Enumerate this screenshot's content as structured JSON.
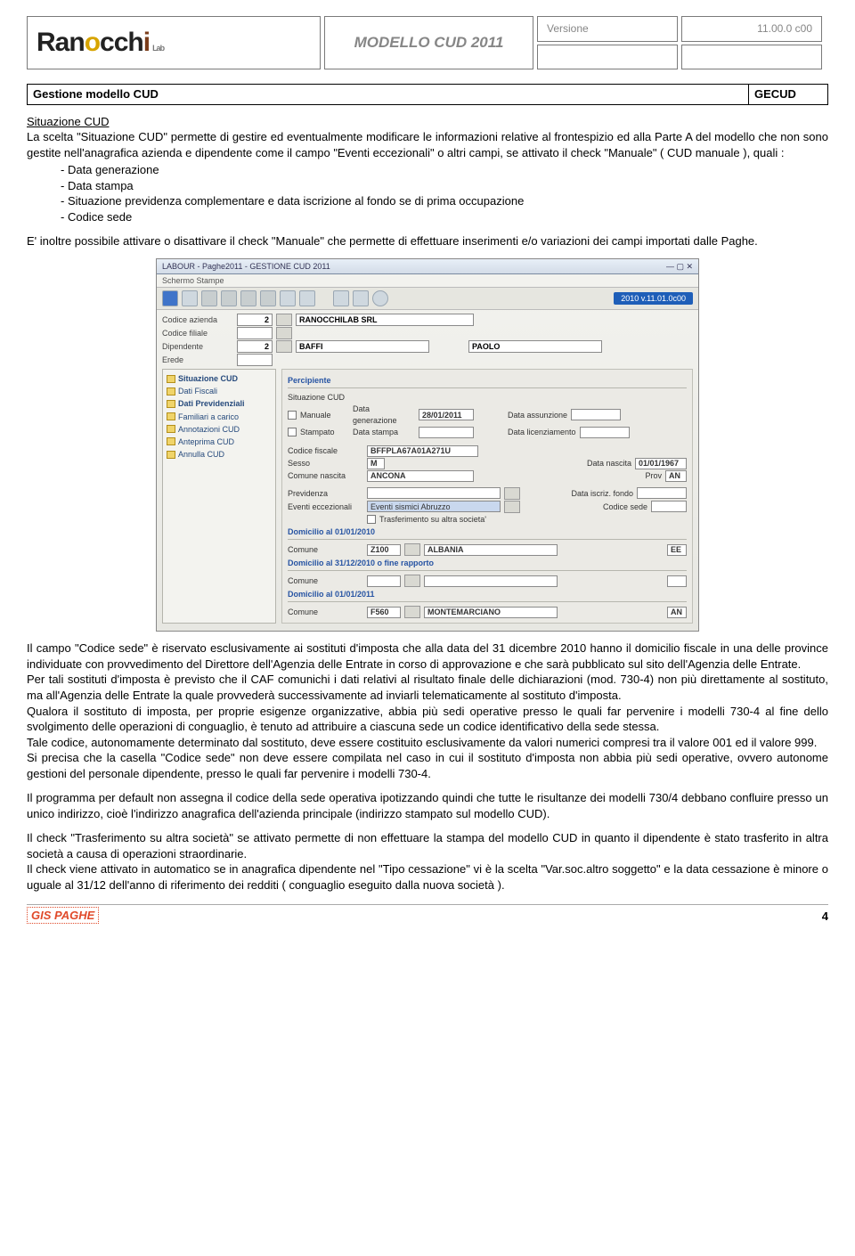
{
  "header": {
    "brand_main": "Ran",
    "brand_o1": "o",
    "brand_mid": "cch",
    "brand_o2": "i",
    "brand_tail": "Lab",
    "doc_title": "MODELLO CUD 2011",
    "version_label": "Versione",
    "version_value": "11.00.0 c00"
  },
  "box": {
    "title": "Gestione modello CUD",
    "code": "GECUD"
  },
  "intro": {
    "heading": "Situazione CUD",
    "p1": "La scelta \"Situazione CUD\" permette di gestire ed eventualmente modificare le informazioni relative al frontespizio ed alla Parte A del modello che non sono gestite nell'anagrafica azienda e dipendente come il campo \"Eventi eccezionali\" o altri campi, se attivato il check \"Manuale\" ( CUD manuale ), quali :",
    "list": [
      "Data generazione",
      "Data stampa",
      "Situazione previdenza complementare e data iscrizione al fondo se di prima occupazione",
      "Codice sede"
    ],
    "p2": "E' inoltre possibile attivare o disattivare il check \"Manuale\" che permette di effettuare inserimenti e/o variazioni dei campi importati dalle Paghe."
  },
  "screenshot": {
    "title": "LABOUR - Paghe2011 - GESTIONE CUD 2011",
    "menu": "Schermo   Stampe",
    "pill": "2010   v.11.01.0c00",
    "fields": {
      "codice_azienda_label": "Codice azienda",
      "codice_azienda_val": "2",
      "azienda_nome": "RANOCCHILAB SRL",
      "codice_filiale_label": "Codice filiale",
      "dipendente_label": "Dipendente",
      "dipendente_val": "2",
      "dip_cognome": "BAFFI",
      "dip_nome": "PAOLO",
      "erede_label": "Erede"
    },
    "sidebar": [
      "Situazione CUD",
      "Dati Fiscali",
      "Dati Previdenziali",
      "Familiari a carico",
      "Annotazioni CUD",
      "Anteprima CUD",
      "Annulla CUD"
    ],
    "panel": {
      "g1_title": "Percipiente",
      "sit_label": "Situazione CUD",
      "manuale_label": "Manuale",
      "stampato_label": "Stampato",
      "data_gen_label": "Data generazione",
      "data_gen_val": "28/01/2011",
      "data_stampa_label": "Data stampa",
      "data_ass_label": "Data assunzione",
      "data_lic_label": "Data licenziamento",
      "cf_label": "Codice fiscale",
      "cf_val": "BFFPLA67A01A271U",
      "sesso_label": "Sesso",
      "sesso_val": "M",
      "nascita_label": "Data nascita",
      "nascita_val": "01/01/1967",
      "comune_nn_label": "Comune nascita",
      "comune_nn_val": "ANCONA",
      "prov_label": "Prov",
      "prov_val": "AN",
      "prev_label": "Previdenza",
      "iscr_label": "Data iscriz. fondo",
      "eventi_label": "Eventi eccezionali",
      "eventi_val": "Eventi sismici Abruzzo",
      "codsede_label": "Codice sede",
      "trasf_label": "Trasferimento su altra societa'",
      "g2_title": "Domicilio al 01/01/2010",
      "comune_label": "Comune",
      "dom1_code": "Z100",
      "dom1_nome": "ALBANIA",
      "dom1_prov": "EE",
      "g3_title": "Domicilio al 31/12/2010 o fine rapporto",
      "g4_title": "Domicilio al 01/01/2011",
      "dom3_code": "F560",
      "dom3_nome": "MONTEMARCIANO",
      "dom3_prov": "AN"
    }
  },
  "body": {
    "p3": "Il campo \"Codice sede\" è riservato esclusivamente ai sostituti d'imposta che alla data del 31 dicembre 2010 hanno il domicilio fiscale in una delle province individuate con provvedimento del Direttore dell'Agenzia delle Entrate in corso di approvazione e che sarà pubblicato sul sito dell'Agenzia delle Entrate.",
    "p4": "Per tali sostituti d'imposta è previsto che il CAF comunichi i dati relativi al risultato finale delle dichiarazioni (mod. 730-4) non più direttamente al sostituto, ma all'Agenzia delle Entrate la quale provvederà successivamente ad inviarli telematicamente al sostituto d'imposta.",
    "p5": "Qualora il sostituto di imposta, per proprie esigenze organizzative, abbia più sedi operative presso le quali far pervenire i modelli 730-4 al fine dello svolgimento delle operazioni di conguaglio, è tenuto ad attribuire a ciascuna sede un codice identificativo della sede stessa.",
    "p6": "Tale codice, autonomamente determinato dal sostituto, deve essere costituito esclusivamente da valori numerici compresi tra il valore 001 ed il valore 999.",
    "p7": "Si precisa che la casella \"Codice sede\" non deve essere compilata nel caso in cui il sostituto d'imposta non abbia più sedi operative, ovvero autonome gestioni del personale dipendente, presso le quali far pervenire i modelli 730-4.",
    "p8": "Il programma per default non assegna il codice della sede operativa ipotizzando quindi che tutte le risultanze dei modelli 730/4 debbano confluire presso un unico indirizzo, cioè l'indirizzo anagrafica dell'azienda principale (indirizzo stampato sul modello CUD).",
    "p9": "Il check \"Trasferimento su altra società\" se attivato permette di non effettuare la stampa del modello CUD in quanto il dipendente è stato trasferito in altra società a causa di operazioni straordinarie.",
    "p10": "Il check viene attivato in automatico se in anagrafica dipendente nel \"Tipo cessazione\" vi è la scelta \"Var.soc.altro soggetto\" e la data cessazione è minore o uguale al 31/12 dell'anno di riferimento dei redditi ( conguaglio eseguito dalla nuova società )."
  },
  "footer": {
    "logo": "GIS PAGHE",
    "page_number": "4"
  }
}
